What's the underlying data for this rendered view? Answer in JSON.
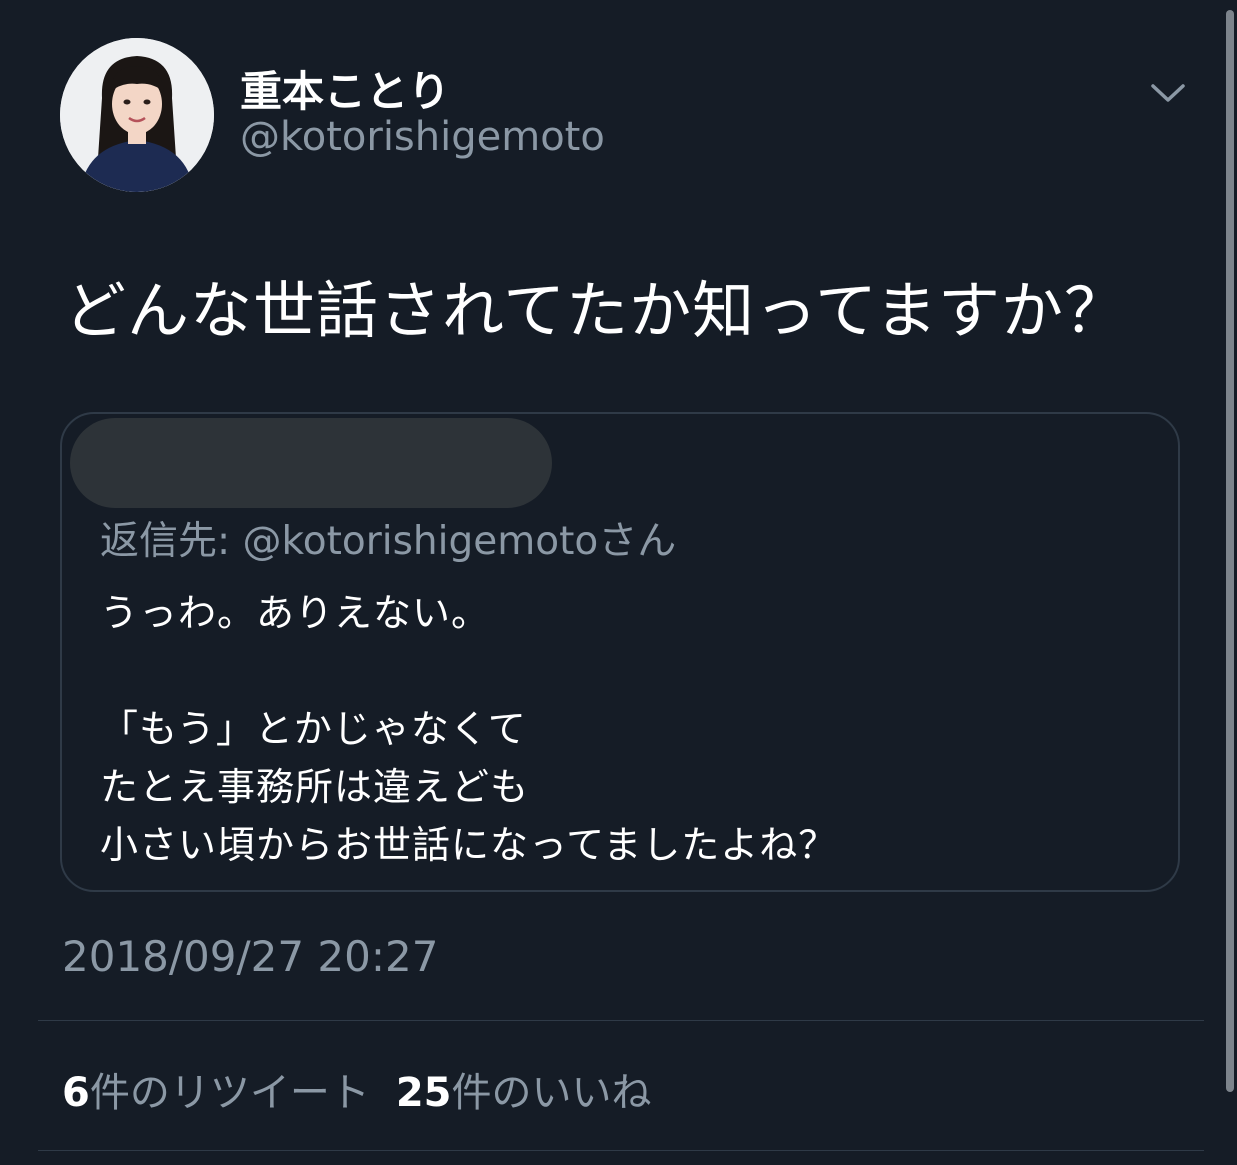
{
  "author": {
    "display_name": "重本ことり",
    "handle": "@kotorishigemoto"
  },
  "tweet": {
    "text": "どんな世話されてたか知ってますか？",
    "timestamp": "2018/09/27 20:27"
  },
  "quoted_tweet": {
    "reply_to": "返信先: @kotorishigemotoさん",
    "lines": [
      "うっわ。ありえない。",
      "",
      "「もう」とかじゃなくて",
      "たとえ事務所は違えども",
      "小さい頃からお世話になってましたよね？"
    ]
  },
  "stats": {
    "retweets_count": "6",
    "retweets_label": "件のリツイート",
    "likes_count": "25",
    "likes_label": "件のいいね"
  },
  "icons": {
    "menu_caret": "chevron-down-icon"
  },
  "colors": {
    "background": "#151c26",
    "secondary_text": "#8b98a5",
    "border": "#2f3a47"
  }
}
